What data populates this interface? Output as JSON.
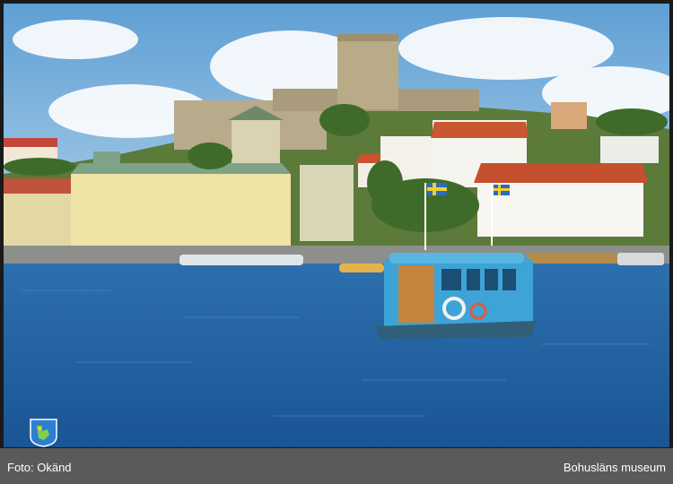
{
  "photo": {
    "alt": "",
    "colors": {
      "sky": "#7fb3dc",
      "water": "#1f5f9c",
      "ferry": "#3ea3d6"
    }
  },
  "caption": {
    "credit": "Foto: Okänd",
    "source": "Bohusläns museum"
  },
  "badge": {
    "icon": "bohuslan-museum-logo-icon",
    "color": "#2e7fd1"
  }
}
